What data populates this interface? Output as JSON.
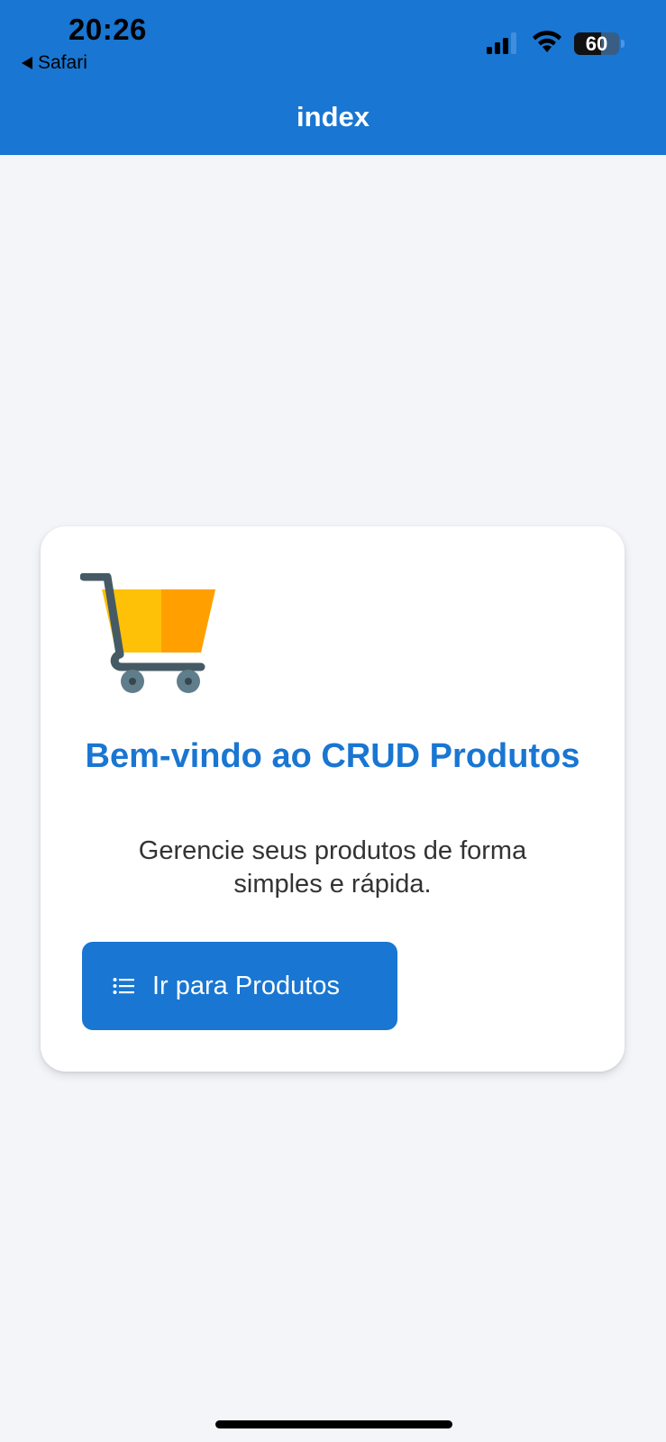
{
  "status_bar": {
    "time": "20:26",
    "back_app": "Safari",
    "battery_level": "60",
    "icons": [
      "cellular-signal-icon",
      "wifi-icon",
      "battery-icon"
    ]
  },
  "header": {
    "title": "index",
    "color": "#1976d2"
  },
  "card": {
    "icon": "shopping-cart-icon",
    "title": "Bem-vindo ao CRUD Produtos",
    "subtitle": "Gerencie seus produtos de forma simples e rápida.",
    "button": {
      "icon": "list-icon",
      "label": "Ir para Produtos"
    }
  },
  "colors": {
    "accent": "#1976d2",
    "background": "#f3f5f9",
    "cart_yellow": "#ffc107",
    "cart_orange": "#ffa000",
    "cart_frame": "#455a64"
  }
}
